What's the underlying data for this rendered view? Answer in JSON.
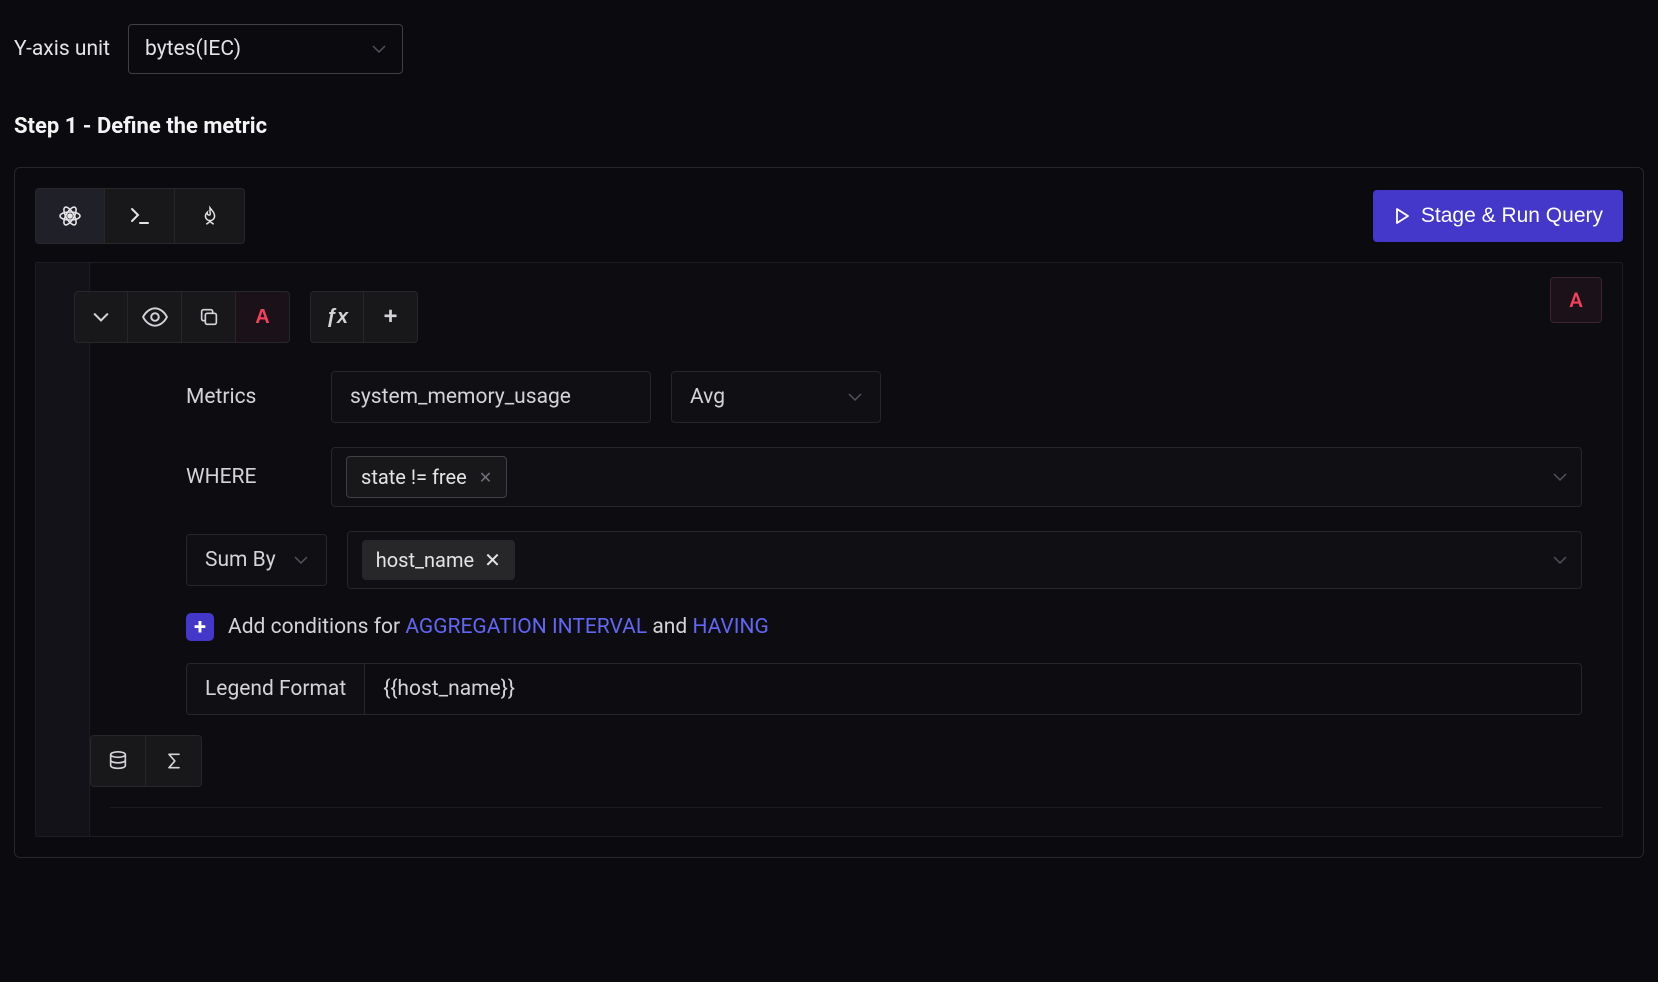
{
  "yaxis": {
    "label": "Y-axis unit",
    "value": "bytes(IEC)"
  },
  "step_header": "Step 1 - Define the metric",
  "run_button": "Stage & Run Query",
  "query": {
    "letter": "A",
    "fx_label": "ƒx",
    "plus_label": "+",
    "metrics_label": "Metrics",
    "metric_value": "system_memory_usage",
    "agg_value": "Avg",
    "where_label": "WHERE",
    "where_tags": [
      "state != free"
    ],
    "groupby_label": "Sum By",
    "groupby_tags": [
      "host_name"
    ],
    "addcond": {
      "prefix": "Add conditions for ",
      "link1": "AGGREGATION INTERVAL",
      "mid": " and ",
      "link2": "HAVING"
    },
    "legend_label": "Legend Format",
    "legend_value": "{{host_name}}"
  }
}
